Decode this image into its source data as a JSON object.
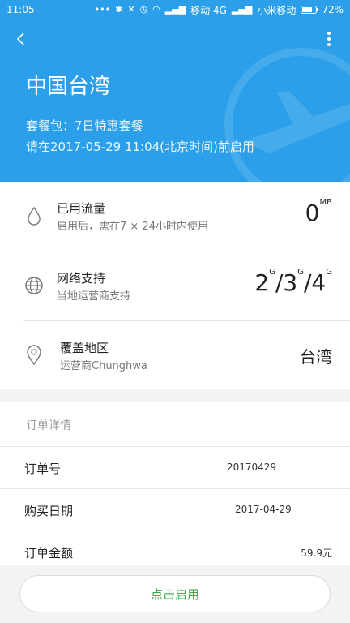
{
  "status_bar": {
    "time": "11:05",
    "carrier1": "移动 4G",
    "carrier2": "小米移动",
    "battery": "72%",
    "battery_level": 0.72
  },
  "header": {
    "title": "中国台湾",
    "package_line": "套餐包：7日特惠套餐",
    "activate_by_line": "请在2017-05-29 11:04(北京时间)前启用"
  },
  "info": {
    "data_used": {
      "label": "已用流量",
      "desc": "启用后，需在7 × 24小时内使用",
      "value": "0",
      "unit": "MB"
    },
    "network": {
      "label": "网络支持",
      "desc": "当地运营商支持",
      "g2": "2",
      "g3": "3",
      "g4": "4",
      "sup": "G",
      "sep": "/"
    },
    "coverage": {
      "label": "覆盖地区",
      "desc": "运营商Chunghwa",
      "value": "台湾"
    }
  },
  "order": {
    "header": "订单详情",
    "rows": [
      {
        "label": "订单号",
        "value": "20170429"
      },
      {
        "label": "购买日期",
        "value": "2017-04-29"
      },
      {
        "label": "订单金额",
        "value": "59.9元"
      }
    ]
  },
  "action": {
    "label": "点击启用"
  },
  "colors": {
    "primary": "#2b9fe9",
    "action_text": "#3aa94a"
  }
}
